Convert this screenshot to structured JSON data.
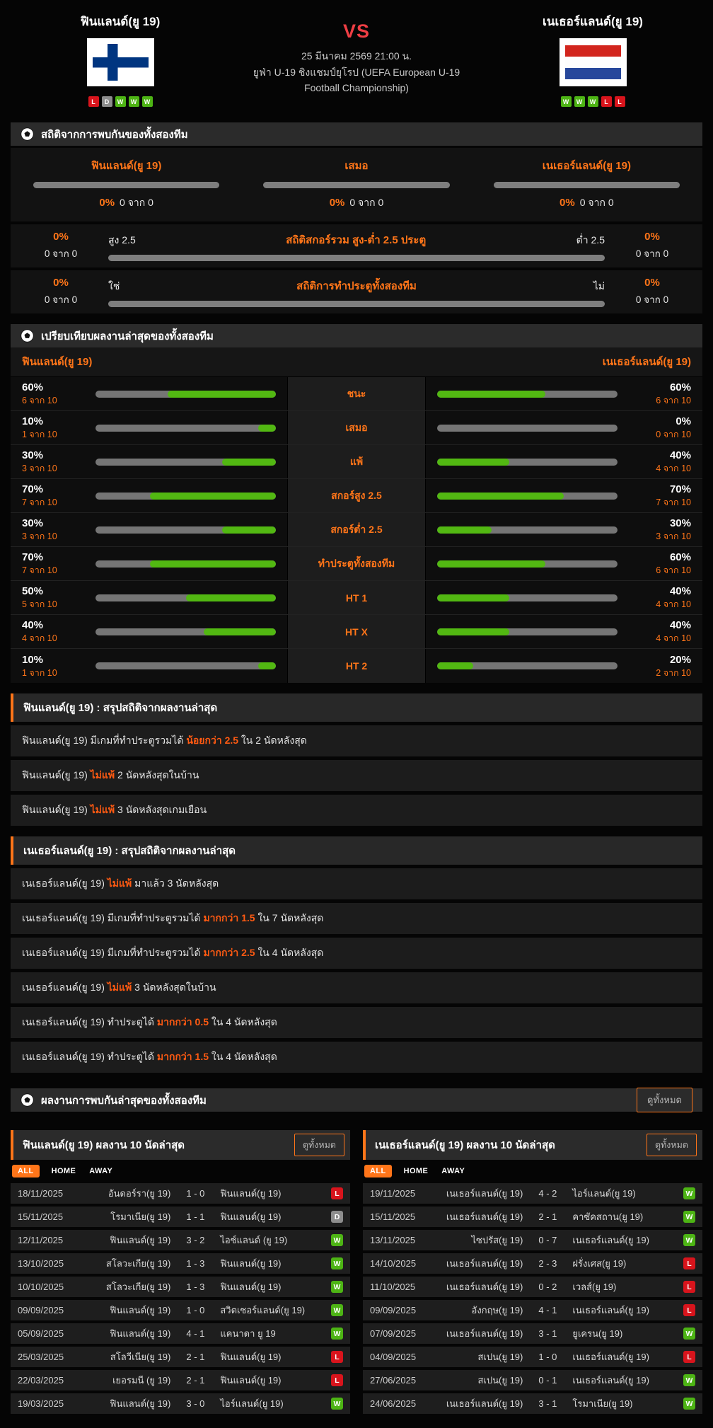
{
  "colors": {
    "accent_orange": "#ff7519",
    "highlight_orange_red": "#ff5a12",
    "win_green": "#4db414",
    "lose_red": "#d8141c",
    "draw_gray": "#8d8d8d",
    "bar_track_gray": "#7e7e7e",
    "bar_fill_green": "#52b812",
    "vs_red": "#ef3e44"
  },
  "header": {
    "home_team": "ฟินแลนด์(ยู 19)",
    "away_team": "เนเธอร์แลนด์(ยู 19)",
    "vs": "VS",
    "datetime": "25 มีนาคม 2569 21:00 น.",
    "competition_line1": "ยูฟ่า U-19 ชิงแชมป์ยุโรป (UEFA European U-19",
    "competition_line2": "Football Championship)",
    "home_flag": "finland-flag",
    "away_flag": "netherlands-flag",
    "home_form": [
      "L",
      "D",
      "W",
      "W",
      "W"
    ],
    "away_form": [
      "W",
      "W",
      "W",
      "L",
      "L"
    ]
  },
  "h2h": {
    "title": "สถิติจากการพบกันของทั้งสองทีม",
    "columns": [
      {
        "label": "ฟินแลนด์(ยู 19)",
        "pct_label": "0%",
        "pct": 0,
        "count": "0 จาก 0"
      },
      {
        "label": "เสมอ",
        "pct_label": "0%",
        "pct": 0,
        "count": "0 จาก 0"
      },
      {
        "label": "เนเธอร์แลนด์(ยู 19)",
        "pct_label": "0%",
        "pct": 0,
        "count": "0 จาก 0"
      }
    ],
    "rows": [
      {
        "title": "สถิติสกอร์รวม สูง-ต่ำ 2.5 ประตู",
        "left_label": "สูง 2.5",
        "right_label": "ต่ำ 2.5",
        "left_pct_label": "0%",
        "left_count": "0 จาก 0",
        "right_pct_label": "0%",
        "right_count": "0 จาก 0",
        "pct": 0
      },
      {
        "title": "สถิติการทำประตูทั้งสองทีม",
        "left_label": "ใช่",
        "right_label": "ไม่",
        "left_pct_label": "0%",
        "left_count": "0 จาก 0",
        "right_pct_label": "0%",
        "right_count": "0 จาก 0",
        "pct": 0
      }
    ]
  },
  "comparison": {
    "title": "เปรียบเทียบผลงานล่าสุดของทั้งสองทีม",
    "home_team": "ฟินแลนด์(ยู 19)",
    "away_team": "เนเธอร์แลนด์(ยู 19)",
    "rows": [
      {
        "label": "ชนะ",
        "home": {
          "pct": 60,
          "label": "60%",
          "count": "6 จาก 10"
        },
        "away": {
          "pct": 60,
          "label": "60%",
          "count": "6 จาก 10"
        }
      },
      {
        "label": "เสมอ",
        "home": {
          "pct": 10,
          "label": "10%",
          "count": "1 จาก 10"
        },
        "away": {
          "pct": 0,
          "label": "0%",
          "count": "0 จาก 10"
        }
      },
      {
        "label": "แพ้",
        "home": {
          "pct": 30,
          "label": "30%",
          "count": "3 จาก 10"
        },
        "away": {
          "pct": 40,
          "label": "40%",
          "count": "4 จาก 10"
        }
      },
      {
        "label": "สกอร์สูง 2.5",
        "home": {
          "pct": 70,
          "label": "70%",
          "count": "7 จาก 10"
        },
        "away": {
          "pct": 70,
          "label": "70%",
          "count": "7 จาก 10"
        }
      },
      {
        "label": "สกอร์ต่ำ 2.5",
        "home": {
          "pct": 30,
          "label": "30%",
          "count": "3 จาก 10"
        },
        "away": {
          "pct": 30,
          "label": "30%",
          "count": "3 จาก 10"
        }
      },
      {
        "label": "ทำประตูทั้งสองทีม",
        "home": {
          "pct": 70,
          "label": "70%",
          "count": "7 จาก 10"
        },
        "away": {
          "pct": 60,
          "label": "60%",
          "count": "6 จาก 10"
        }
      },
      {
        "label": "HT 1",
        "home": {
          "pct": 50,
          "label": "50%",
          "count": "5 จาก 10"
        },
        "away": {
          "pct": 40,
          "label": "40%",
          "count": "4 จาก 10"
        }
      },
      {
        "label": "HT X",
        "home": {
          "pct": 40,
          "label": "40%",
          "count": "4 จาก 10"
        },
        "away": {
          "pct": 40,
          "label": "40%",
          "count": "4 จาก 10"
        }
      },
      {
        "label": "HT 2",
        "home": {
          "pct": 10,
          "label": "10%",
          "count": "1 จาก 10"
        },
        "away": {
          "pct": 20,
          "label": "20%",
          "count": "2 จาก 10"
        }
      }
    ]
  },
  "home_summary": {
    "title": "ฟินแลนด์(ยู 19) : สรุปสถิติจากผลงานล่าสุด",
    "rows": [
      {
        "pre": "ฟินแลนด์(ยู 19) มีเกมที่ทำประตูรวมได้ ",
        "hl": "น้อยกว่า 2.5",
        "post": " ใน 2 นัดหลังสุด"
      },
      {
        "pre": "ฟินแลนด์(ยู 19) ",
        "hl": "ไม่แพ้",
        "post": " 2 นัดหลังสุดในบ้าน"
      },
      {
        "pre": "ฟินแลนด์(ยู 19) ",
        "hl": "ไม่แพ้",
        "post": " 3 นัดหลังสุดเกมเยือน"
      }
    ]
  },
  "away_summary": {
    "title": "เนเธอร์แลนด์(ยู 19) : สรุปสถิติจากผลงานล่าสุด",
    "rows": [
      {
        "pre": "เนเธอร์แลนด์(ยู 19) ",
        "hl": "ไม่แพ้",
        "post": " มาแล้ว 3 นัดหลังสุด"
      },
      {
        "pre": "เนเธอร์แลนด์(ยู 19) มีเกมที่ทำประตูรวมได้ ",
        "hl": "มากกว่า 1.5",
        "post": " ใน 7 นัดหลังสุด"
      },
      {
        "pre": "เนเธอร์แลนด์(ยู 19) มีเกมที่ทำประตูรวมได้ ",
        "hl": "มากกว่า 2.5",
        "post": " ใน 4 นัดหลังสุด"
      },
      {
        "pre": "เนเธอร์แลนด์(ยู 19) ",
        "hl": "ไม่แพ้",
        "post": " 3 นัดหลังสุดในบ้าน"
      },
      {
        "pre": "เนเธอร์แลนด์(ยู 19) ทำประตูได้ ",
        "hl": "มากกว่า 0.5",
        "post": " ใน 4 นัดหลังสุด"
      },
      {
        "pre": "เนเธอร์แลนด์(ยู 19) ทำประตูได้ ",
        "hl": "มากกว่า 1.5",
        "post": " ใน 4 นัดหลังสุด"
      }
    ]
  },
  "recent": {
    "title": "ผลงานการพบกันล่าสุดของทั้งสองทีม",
    "view_all": "ดูทั้งหมด",
    "panels": [
      {
        "title": "ฟินแลนด์(ยู 19) ผลงาน 10 นัดล่าสุด",
        "view_all": "ดูทั้งหมด",
        "tabs": [
          "ALL",
          "HOME",
          "AWAY"
        ],
        "active_tab": "ALL",
        "matches": [
          {
            "date": "18/11/2025",
            "home": "อันดอร์รา(ยู 19)",
            "score": "1 - 0",
            "away": "ฟินแลนด์(ยู 19)",
            "result": "L"
          },
          {
            "date": "15/11/2025",
            "home": "โรมาเนีย(ยู 19)",
            "score": "1 - 1",
            "away": "ฟินแลนด์(ยู 19)",
            "result": "D"
          },
          {
            "date": "12/11/2025",
            "home": "ฟินแลนด์(ยู 19)",
            "score": "3 - 2",
            "away": "ไอซ์แลนด์ (ยู 19)",
            "result": "W"
          },
          {
            "date": "13/10/2025",
            "home": "สโลวะเกีย(ยู 19)",
            "score": "1 - 3",
            "away": "ฟินแลนด์(ยู 19)",
            "result": "W"
          },
          {
            "date": "10/10/2025",
            "home": "สโลวะเกีย(ยู 19)",
            "score": "1 - 3",
            "away": "ฟินแลนด์(ยู 19)",
            "result": "W"
          },
          {
            "date": "09/09/2025",
            "home": "ฟินแลนด์(ยู 19)",
            "score": "1 - 0",
            "away": "สวิตเซอร์แลนด์(ยู 19)",
            "result": "W"
          },
          {
            "date": "05/09/2025",
            "home": "ฟินแลนด์(ยู 19)",
            "score": "4 - 1",
            "away": "แคนาดา ยู 19",
            "result": "W"
          },
          {
            "date": "25/03/2025",
            "home": "สโลวีเนีย(ยู 19)",
            "score": "2 - 1",
            "away": "ฟินแลนด์(ยู 19)",
            "result": "L"
          },
          {
            "date": "22/03/2025",
            "home": "เยอรมนี (ยู 19)",
            "score": "2 - 1",
            "away": "ฟินแลนด์(ยู 19)",
            "result": "L"
          },
          {
            "date": "19/03/2025",
            "home": "ฟินแลนด์(ยู 19)",
            "score": "3 - 0",
            "away": "ไอร์แลนด์(ยู 19)",
            "result": "W"
          }
        ]
      },
      {
        "title": "เนเธอร์แลนด์(ยู 19) ผลงาน 10 นัดล่าสุด",
        "view_all": "ดูทั้งหมด",
        "tabs": [
          "ALL",
          "HOME",
          "AWAY"
        ],
        "active_tab": "ALL",
        "matches": [
          {
            "date": "19/11/2025",
            "home": "เนเธอร์แลนด์(ยู 19)",
            "score": "4 - 2",
            "away": "ไอร์แลนด์(ยู 19)",
            "result": "W"
          },
          {
            "date": "15/11/2025",
            "home": "เนเธอร์แลนด์(ยู 19)",
            "score": "2 - 1",
            "away": "คาซัคสถาน(ยู 19)",
            "result": "W"
          },
          {
            "date": "13/11/2025",
            "home": "ไซปรัส(ยู 19)",
            "score": "0 - 7",
            "away": "เนเธอร์แลนด์(ยู 19)",
            "result": "W"
          },
          {
            "date": "14/10/2025",
            "home": "เนเธอร์แลนด์(ยู 19)",
            "score": "2 - 3",
            "away": "ฝรั่งเศส(ยู 19)",
            "result": "L"
          },
          {
            "date": "11/10/2025",
            "home": "เนเธอร์แลนด์(ยู 19)",
            "score": "0 - 2",
            "away": "เวลส์(ยู 19)",
            "result": "L"
          },
          {
            "date": "09/09/2025",
            "home": "อังกฤษ(ยู 19)",
            "score": "4 - 1",
            "away": "เนเธอร์แลนด์(ยู 19)",
            "result": "L"
          },
          {
            "date": "07/09/2025",
            "home": "เนเธอร์แลนด์(ยู 19)",
            "score": "3 - 1",
            "away": "ยูเครน(ยู 19)",
            "result": "W"
          },
          {
            "date": "04/09/2025",
            "home": "สเปน(ยู 19)",
            "score": "1 - 0",
            "away": "เนเธอร์แลนด์(ยู 19)",
            "result": "L"
          },
          {
            "date": "27/06/2025",
            "home": "สเปน(ยู 19)",
            "score": "0 - 1",
            "away": "เนเธอร์แลนด์(ยู 19)",
            "result": "W"
          },
          {
            "date": "24/06/2025",
            "home": "เนเธอร์แลนด์(ยู 19)",
            "score": "3 - 1",
            "away": "โรมาเนีย(ยู 19)",
            "result": "W"
          }
        ]
      }
    ]
  }
}
